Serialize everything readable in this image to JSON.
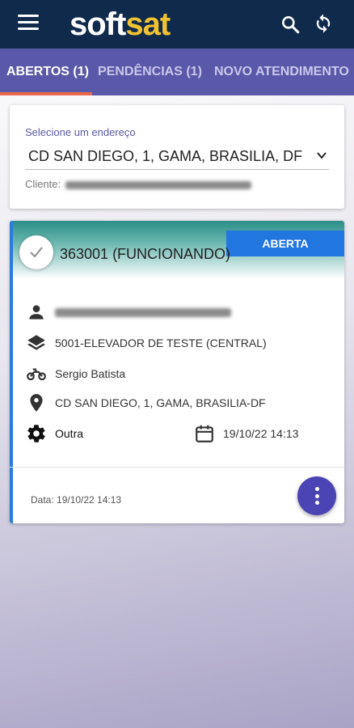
{
  "header": {
    "logo_part1": "soft",
    "logo_part2": "sat"
  },
  "tabs": [
    {
      "label": "ABERTOS (1)"
    },
    {
      "label": "PENDÊNCIAS (1)"
    },
    {
      "label": "NOVO ATENDIMENTO"
    }
  ],
  "address": {
    "label": "Selecione um endereço",
    "value": "CD SAN DIEGO, 1, GAMA, BRASILIA, DF",
    "client_label": "Cliente:"
  },
  "order": {
    "status": "ABERTA",
    "title": "363001 (FUNCIONANDO)",
    "equipment": "5001-ELEVADOR DE TESTE (CENTRAL)",
    "technician": "Sergio Batista",
    "location": "CD SAN DIEGO, 1, GAMA, BRASILIA-DF",
    "type": "Outra",
    "datetime": "19/10/22 14:13",
    "footer_date": "Data: 19/10/22 14:13"
  },
  "colors": {
    "appbar": "#102a4c",
    "tabs": "#5a58a8",
    "logo_accent": "#f1c232",
    "badge": "#2176e0",
    "fab": "#4a44b4"
  }
}
